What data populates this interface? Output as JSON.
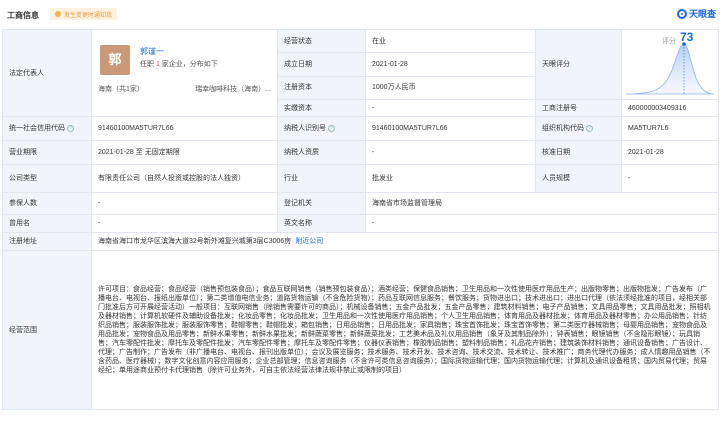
{
  "header": {
    "title": "工商信息",
    "badge": "发生变更时通知我",
    "brand": "天眼查"
  },
  "legal_rep": {
    "label": "法定代表人",
    "avatar_char": "郭",
    "name": "郭谨一",
    "sub_prefix": "任职 ",
    "sub_count": "1",
    "sub_suffix": " 家企业，分布如下",
    "tag_left": "海南（共1家）",
    "tag_right": "瑞幸咖啡科技（海南）..."
  },
  "status": {
    "label": "经营状态",
    "value": "在业"
  },
  "established": {
    "label": "成立日期",
    "value": "2021-01-28"
  },
  "capital": {
    "label": "注册资本",
    "value": "1000万人民币"
  },
  "paid_capital": {
    "label": "实缴资本",
    "value": "-"
  },
  "score": {
    "label": "天眼评分",
    "prefix": "评分",
    "value": "73"
  },
  "reg_number": {
    "label": "工商注册号",
    "value": "460000003409316"
  },
  "credit_code": {
    "label": "统一社会信用代码",
    "value": "91460100MA5TUR7L66"
  },
  "taxpayer_id": {
    "label": "纳税人识别号",
    "value": "91460100MA5TUR7L66"
  },
  "org_code": {
    "label": "组织机构代码",
    "value": "MA5TUR7L6"
  },
  "term": {
    "label": "营业期限",
    "value": "2021-01-28 至 无固定期限"
  },
  "taxpayer_qual": {
    "label": "纳税人资质",
    "value": "-"
  },
  "approval_date": {
    "label": "核准日期",
    "value": "2021-01-28"
  },
  "company_type": {
    "label": "公司类型",
    "value": "有限责任公司（自然人投资或控股的法人独资）"
  },
  "industry": {
    "label": "行业",
    "value": "批发业"
  },
  "staff_size": {
    "label": "人员规模",
    "value": "-"
  },
  "insured": {
    "label": "参保人数",
    "value": "-"
  },
  "authority": {
    "label": "登记机关",
    "value": "海南省市场监督管理局"
  },
  "former_name": {
    "label": "曾用名",
    "value": "-"
  },
  "english_name": {
    "label": "英文名称",
    "value": "-"
  },
  "address": {
    "label": "注册地址",
    "value": "海南省海口市龙华区滨海大道32号新外滩复兴城第3层C3006房",
    "link": "附近公司"
  },
  "scope": {
    "label": "经营范围",
    "value": "许可项目：食品经营；食品经营（销售预包装食品）；食品互联网销售（销售预包装食品）；酒类经营；保健食品销售；卫生用品和一次性使用医疗用品生产；出版物零售；出版物批发；广告发布（广播电台、电视台、报纸出版单位）；第二类增值电信业务；道路货物运输（不含危险货物）；药品互联网信息服务；餐饮服务；货物进出口；技术进出口；进出口代理（依法须经批准的项目，经相关部门批准后方可开展经营活动）一般项目：互联网销售（除销售需要许可的商品）；机械设备销售；五金产品批发；五金产品零售；建筑材料销售；电子产品销售；文具用品零售；文具用品批发；照相机及器材销售；计算机软硬件及辅助设备批发；化妆品零售；化妆品批发；卫生用品和一次性使用医疗用品销售；个人卫生用品销售；体育用品及器材批发；体育用品及器材零售；办公用品销售；针纺织品销售；服装服饰批发；服装服饰零售；鞋帽零售；鞋帽批发；箱包销售；日用品销售；日用品批发；家具销售；珠宝首饰批发；珠宝首饰零售；第二类医疗器械销售；母婴用品销售；宠物食品及用品批发；宠物食品及用品零售；新鲜水果零售；新鲜水果批发；新鲜蔬菜零售；新鲜蔬菜批发；工艺美术品及礼仪用品销售（象牙及其制品除外）；钟表销售；眼镜销售（不含隐形眼镜）；玩具销售；汽车零配件批发；摩托车及零配件批发；汽车零配件零售；摩托车及零配件零售；仪器仪表销售；橡胶制品销售；塑料制品销售；礼品花卉销售；建筑装饰材料销售；通讯设备销售；广告设计、代理；广告制作；广告发布（非广播电台、电视台、报刊出版单位）；会议及展览服务；技术服务、技术开发、技术咨询、技术交流、技术转让、技术推广；商务代理代办服务；成人情趣用品销售（不含药品、医疗器械）；数字文化创意内容应用服务；企业总部管理；信息咨询服务（不含许可类信息咨询服务）；国际货物运输代理；国内货物运输代理；计算机及通讯设备租赁；国内贸易代理；贸易经纪；单用途商业预付卡代理销售（除许可业务外，可自主依法经营法律法规非禁止或限制的项目）"
  },
  "colors": {
    "accent": "#1d69d6",
    "label_bg": "#f1f5fb",
    "border": "#e2e6ee",
    "avatar": "#c9997a"
  },
  "icons": [
    "bell-icon",
    "help-circle-icon",
    "tianyancha-logo-icon"
  ]
}
